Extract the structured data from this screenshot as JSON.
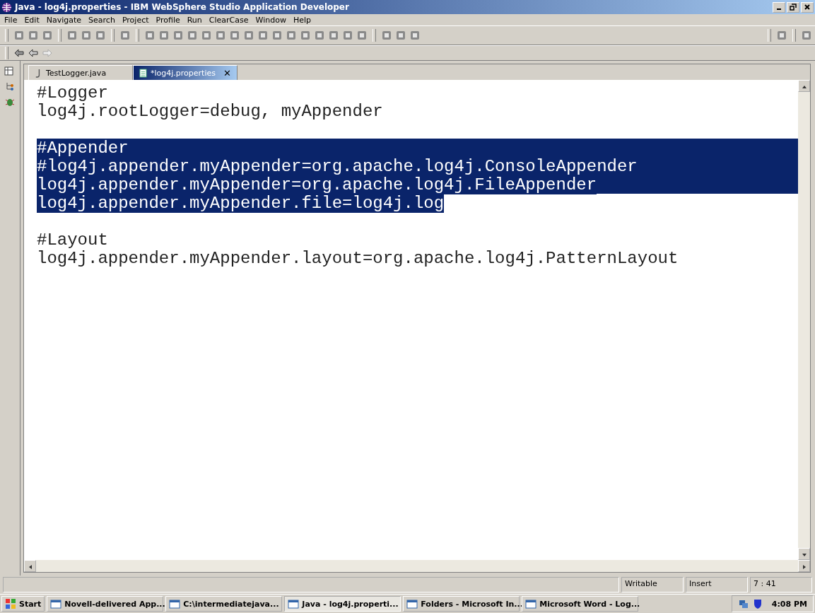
{
  "window": {
    "title": "Java - log4j.properties - IBM WebSphere Studio Application Developer"
  },
  "menu": [
    "File",
    "Edit",
    "Navigate",
    "Search",
    "Project",
    "Profile",
    "Run",
    "ClearCase",
    "Window",
    "Help"
  ],
  "tabs": [
    {
      "label": "TestLogger.java",
      "kind": "java",
      "selected": false
    },
    {
      "label": "*log4j.properties",
      "kind": "file",
      "selected": true
    }
  ],
  "close_glyph": "✕",
  "editor": {
    "lines": [
      {
        "text": "#Logger",
        "selected": false
      },
      {
        "text": "log4j.rootLogger=debug, myAppender",
        "selected": false
      },
      {
        "selected": false
      },
      {
        "text": "#Appender",
        "selected": true
      },
      {
        "text": "#log4j.appender.myAppender=org.apache.log4j.ConsoleAppender",
        "selected": true
      },
      {
        "text": "log4j.appender.myAppender=org.apache.log4j.FileAppender",
        "selected": true
      },
      {
        "text": "log4j.appender.myAppender.file=log4j.log",
        "selected": true
      },
      {
        "selected": false
      },
      {
        "text": "#Layout",
        "selected": false
      },
      {
        "text": "log4j.appender.myAppender.layout=org.apache.log4j.PatternLayout",
        "selected": false
      }
    ]
  },
  "status_bar": [
    "Writable",
    "Insert",
    "7 : 41"
  ],
  "taskbar": {
    "start": "Start",
    "items": [
      {
        "label": "Novell-delivered App...",
        "selected": false
      },
      {
        "label": "C:\\intermediatejava...",
        "selected": false
      },
      {
        "label": "Java - log4j.properti...",
        "selected": true
      },
      {
        "label": "Folders - Microsoft In...",
        "selected": false
      },
      {
        "label": "Microsoft Word - Log...",
        "selected": false
      }
    ],
    "clock": "4:08 PM"
  }
}
